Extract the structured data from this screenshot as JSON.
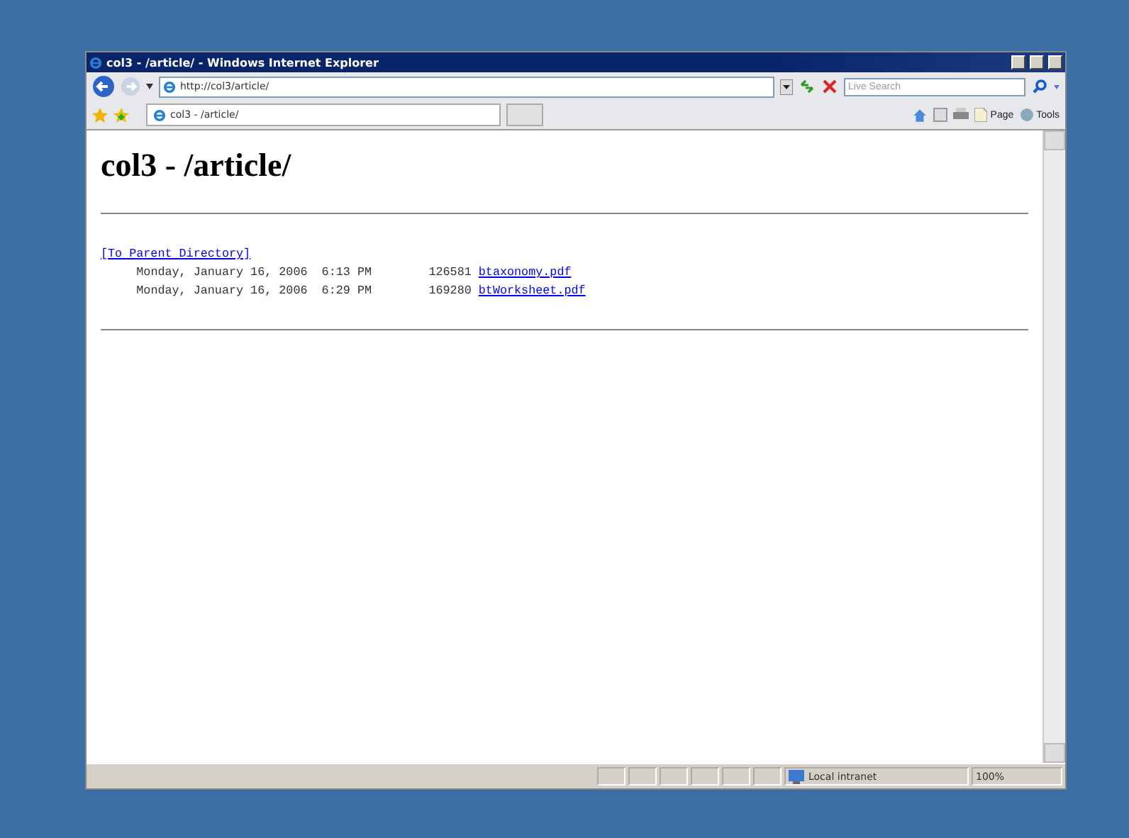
{
  "window": {
    "title": "col3 - /article/ - Windows Internet Explorer"
  },
  "address_bar": {
    "url": "http://col3/article/"
  },
  "search": {
    "placeholder": "Live Search"
  },
  "tab": {
    "label": "col3 - /article/",
    "selected": true
  },
  "command_bar": {
    "page": "Page",
    "tools": "Tools"
  },
  "page": {
    "heading": "col3 - /article/",
    "parent_link": "[To Parent Directory]",
    "rows": [
      {
        "date": "Monday, January 16, 2006  6:13 PM",
        "size": "126581",
        "file": "btaxonomy.pdf"
      },
      {
        "date": "Monday, January 16, 2006  6:29 PM",
        "size": "169280",
        "file": "btWorksheet.pdf"
      }
    ]
  },
  "status_bar": {
    "zone": "Local intranet",
    "zoom": "100%"
  }
}
